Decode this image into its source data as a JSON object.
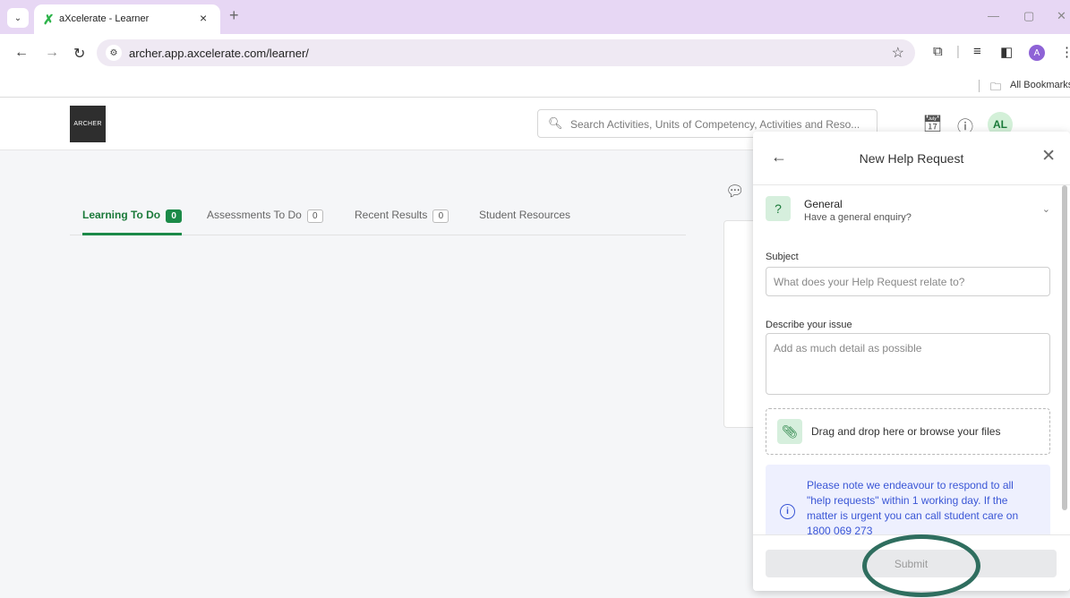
{
  "browser": {
    "tab": {
      "title": "aXcelerate - Learner",
      "close": "×",
      "favicon": "✗"
    },
    "new_tab": "+",
    "url": "archer.app.axcelerate.com/learner/",
    "bookmarks_label": "All Bookmarks",
    "profile_initial": "A"
  },
  "header": {
    "logo_text": "ARCHER",
    "search_placeholder": "Search Activities, Units of Competency, Activities and Reso...",
    "avatar_initials": "AL"
  },
  "page_tabs": [
    {
      "label": "Learning To Do",
      "count": "0",
      "active": true
    },
    {
      "label": "Assessments To Do",
      "count": "0",
      "active": false
    },
    {
      "label": "Recent Results",
      "count": "0",
      "active": false
    },
    {
      "label": "Student Resources",
      "active": false
    }
  ],
  "help_panel": {
    "title": "New Help Request",
    "category": {
      "title": "General",
      "subtitle": "Have a general enquiry?"
    },
    "subject_label": "Subject",
    "subject_placeholder": "What does your Help Request relate to?",
    "issue_label": "Describe your issue",
    "issue_placeholder": "Add as much detail as possible",
    "dropzone_text": "Drag and drop here or browse your files",
    "notice_text": "Please note we endeavour to respond to all \"help requests\" within 1 working day. If the matter is urgent you can call student care on 1800 069 273",
    "submit_label": "Submit"
  },
  "colors": {
    "accent_green": "#1b8a48",
    "notice_blue": "#3a56d6",
    "annotation": "#2f6e5f"
  },
  "icons": [
    "tab-list-icon",
    "back-icon",
    "forward-icon",
    "reload-icon",
    "site-info-icon",
    "star-icon",
    "extensions-icon",
    "reading-list-icon",
    "side-panel-icon",
    "menu-icon",
    "folder-icon",
    "search-icon",
    "calendar-icon",
    "help-icon",
    "chat-icon",
    "help-circle-icon",
    "chevron-down-icon",
    "close-icon",
    "paperclip-icon",
    "info-icon"
  ]
}
